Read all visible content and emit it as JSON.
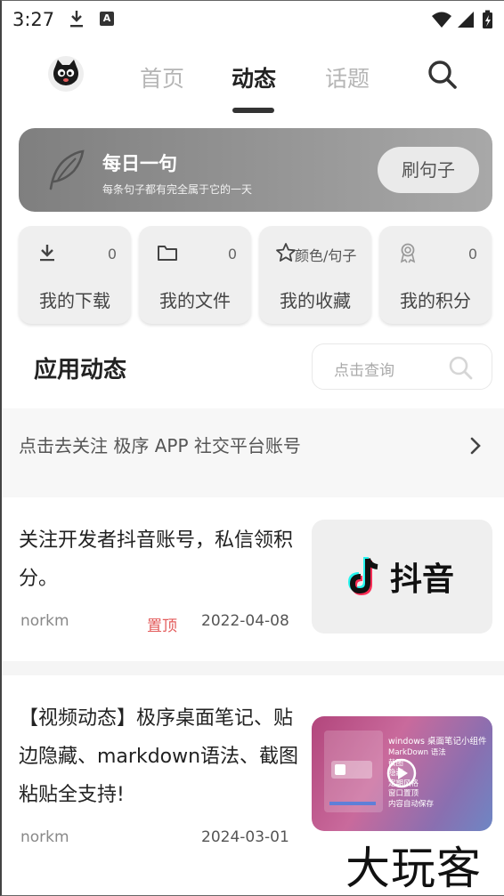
{
  "status_bar": {
    "time": "3:27",
    "badge": "A"
  },
  "nav": {
    "tabs": [
      {
        "label": "首页"
      },
      {
        "label": "动态"
      },
      {
        "label": "话题"
      }
    ],
    "active_tab": "动态"
  },
  "banner": {
    "title": "每日一句",
    "subtitle": "每条句子都有完全属于它的一天",
    "button": "刷句子"
  },
  "quick_cards": [
    {
      "icon": "download-icon",
      "count": "0",
      "label": "我的下载"
    },
    {
      "icon": "folder-icon",
      "count": "0",
      "label": "我的文件"
    },
    {
      "icon": "star-icon",
      "extra": "颜色/句子",
      "label": "我的收藏"
    },
    {
      "icon": "badge-icon",
      "count": "0",
      "label": "我的积分"
    }
  ],
  "section": {
    "title": "应用动态",
    "search_placeholder": "点击查询"
  },
  "follow_banner": {
    "text": "点击去关注 极序 APP 社交平台账号"
  },
  "posts": [
    {
      "text": "关注开发者抖音账号，私信领积分。",
      "author": "norkm",
      "pinned": "置顶",
      "date": "2022-04-08",
      "thumb_text": "抖音"
    },
    {
      "text": "【视频动态】极序桌面笔记、贴边隐藏、markdown语法、截图粘贴全支持!",
      "author": "norkm",
      "date": "2024-03-01",
      "thumb": {
        "title": "windows 桌面笔记小组件",
        "items": [
          "MarkDown 语法",
          "截图",
          "隐藏",
          "定期风格",
          "窗口置顶",
          "内容自动保存"
        ]
      }
    }
  ],
  "watermark": "大玩客",
  "colors": {
    "accent_red": "#e35b5b",
    "banner_start": "#7f7f7f",
    "banner_end": "#a8a8a8"
  }
}
